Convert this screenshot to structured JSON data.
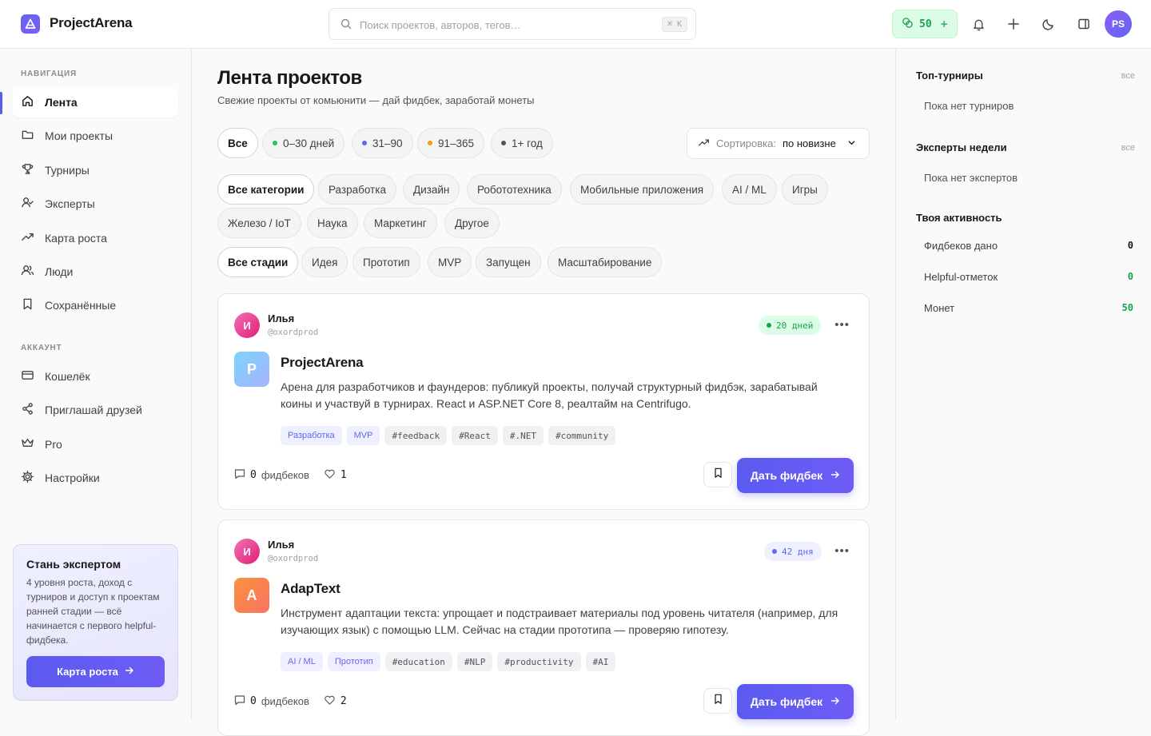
{
  "header": {
    "brand": "ProjectArena",
    "search_placeholder": "Поиск проектов, авторов, тегов…",
    "search_shortcut": "⌘ K",
    "coins": "50",
    "coins_plus": "+",
    "avatar_initials": "PS"
  },
  "sidebar": {
    "nav_title": "НАВИГАЦИЯ",
    "nav": [
      {
        "label": "Лента",
        "icon": "home-icon"
      },
      {
        "label": "Мои проекты",
        "icon": "folder-icon"
      },
      {
        "label": "Турниры",
        "icon": "trophy-icon"
      },
      {
        "label": "Эксперты",
        "icon": "user-check-icon"
      },
      {
        "label": "Карта роста",
        "icon": "trending-up-icon"
      },
      {
        "label": "Люди",
        "icon": "users-icon"
      },
      {
        "label": "Сохранённые",
        "icon": "bookmark-icon"
      }
    ],
    "account_title": "АККАУНТ",
    "account": [
      {
        "label": "Кошелёк",
        "icon": "wallet-icon"
      },
      {
        "label": "Приглашай друзей",
        "icon": "share-icon"
      },
      {
        "label": "Pro",
        "icon": "crown-icon"
      },
      {
        "label": "Настройки",
        "icon": "gear-icon"
      }
    ],
    "promo": {
      "title": "Стань экспертом",
      "text": "4 уровня роста, доход с турниров и доступ к проектам ранней стадии — всё начинается с первого helpful-фидбека.",
      "button": "Карта роста"
    }
  },
  "main": {
    "title": "Лента проектов",
    "subtitle": "Свежие проекты от комьюнити — дай фидбек, заработай монеты",
    "age_filters": [
      {
        "label": "Все",
        "color": ""
      },
      {
        "label": "0–30 дней",
        "color": "#22c55e"
      },
      {
        "label": "31–90",
        "color": "#6366f1"
      },
      {
        "label": "91–365",
        "color": "#f59e0b"
      },
      {
        "label": "1+ год",
        "color": "#52525b"
      }
    ],
    "sort_label": "Сортировка:",
    "sort_value": "по новизне",
    "categories": [
      "Все категории",
      "Разработка",
      "Дизайн",
      "Робототехника",
      "Мобильные приложения",
      "AI / ML",
      "Игры",
      "Железо / IoT",
      "Наука",
      "Маркетинг",
      "Другое"
    ],
    "stages": [
      "Все стадии",
      "Идея",
      "Прототип",
      "MVP",
      "Запущен",
      "Масштабирование"
    ],
    "cards": [
      {
        "author_initial": "И",
        "author": "Илья",
        "handle": "@oxordprod",
        "age": "20 дней",
        "project_initial": "P",
        "title": "ProjectArena",
        "description": "Арена для разработчиков и фаундеров: публикуй проекты, получай структурный фидбэк, зарабатывай коины и участвуй в турнирах. React и ASP.NET Core 8, реалтайм на Centrifugo.",
        "tags_cat": [
          "Разработка",
          "MVP"
        ],
        "tags": [
          "#feedback",
          "#React",
          "#.NET",
          "#community"
        ],
        "feedback_count": "0",
        "feedback_label": "фидбеков",
        "likes": "1",
        "button": "Дать фидбек"
      },
      {
        "author_initial": "И",
        "author": "Илья",
        "handle": "@oxordprod",
        "age": "42 дня",
        "project_initial": "A",
        "title": "AdapText",
        "description": "Инструмент адаптации текста: упрощает и подстраивает материалы под уровень читателя (например, для изучающих язык) с помощью LLM. Сейчас на стадии прототипа — проверяю гипотезу.",
        "tags_cat": [
          "AI / ML",
          "Прототип"
        ],
        "tags": [
          "#education",
          "#NLP",
          "#productivity",
          "#AI"
        ],
        "feedback_count": "0",
        "feedback_label": "фидбеков",
        "likes": "2",
        "button": "Дать фидбек"
      }
    ]
  },
  "right": {
    "tournaments_title": "Топ-турниры",
    "tournaments_all": "все",
    "tournaments_empty": "Пока нет турниров",
    "experts_title": "Эксперты недели",
    "experts_all": "все",
    "experts_empty": "Пока нет экспертов",
    "activity_title": "Твоя активность",
    "activity": [
      {
        "label": "Фидбеков дано",
        "value": "0",
        "color": "#18181b"
      },
      {
        "label": "Helpful-отметок",
        "value": "0",
        "color": "#16a34a"
      },
      {
        "label": "Монет",
        "value": "50",
        "color": "#16a34a"
      }
    ]
  },
  "colors": {
    "accent": "#5b5bf0",
    "success": "#16a34a",
    "age_green_bg": "#dcfce7",
    "age_blue_bg": "#eef0ff"
  }
}
